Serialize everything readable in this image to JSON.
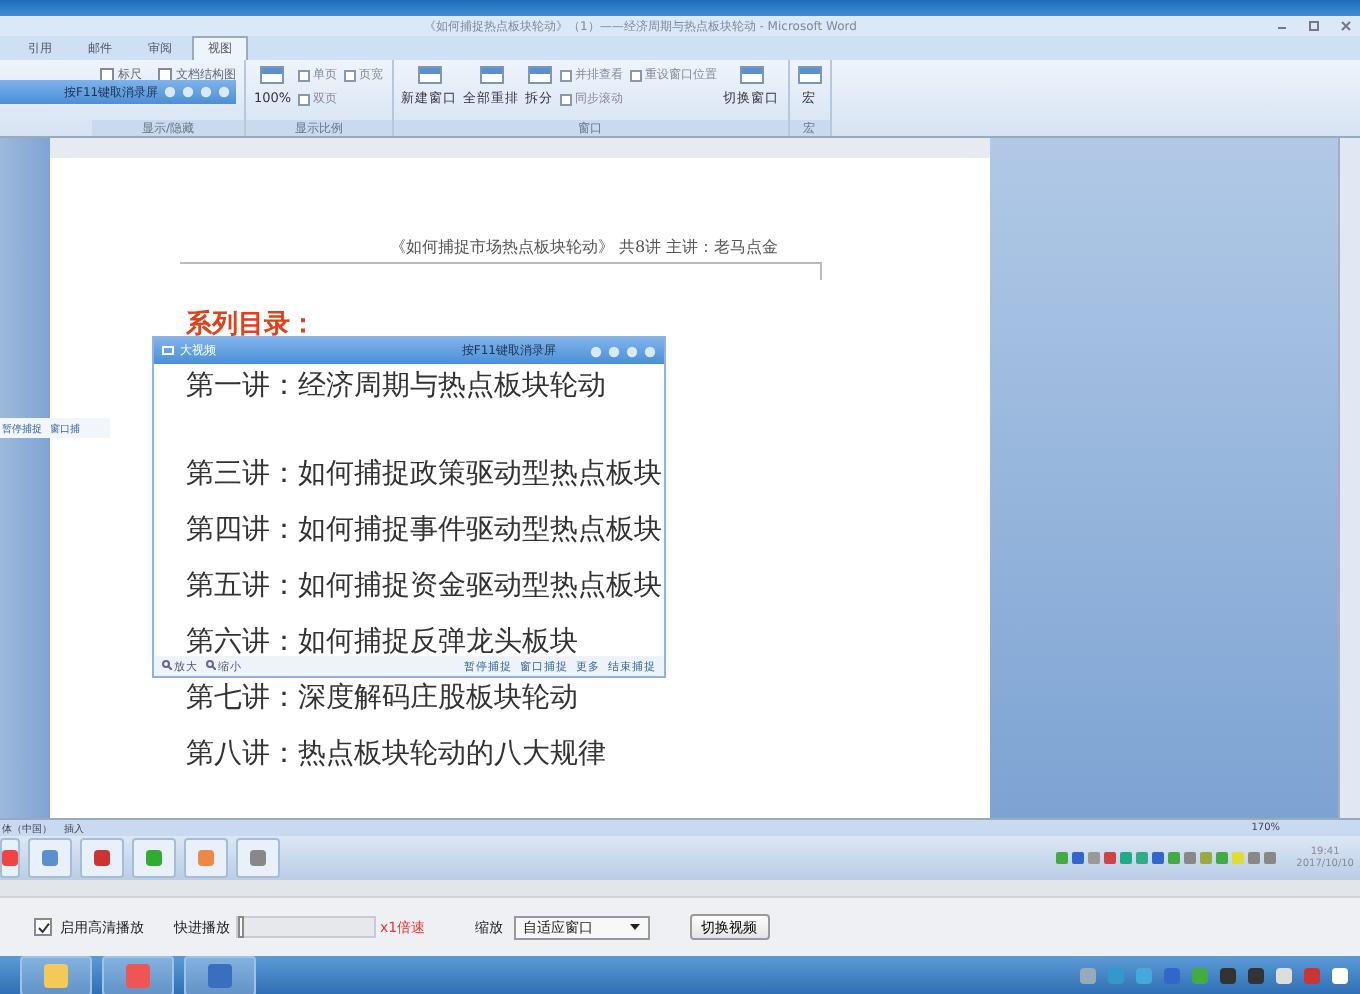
{
  "window": {
    "title": "《如何捕捉热点板块轮动》（1）——经济周期与热点板块轮动 - Microsoft Word"
  },
  "ribbon": {
    "tabs": [
      {
        "label": "引用",
        "selected": false
      },
      {
        "label": "邮件",
        "selected": false
      },
      {
        "label": "审阅",
        "selected": false
      },
      {
        "label": "视图",
        "selected": true
      }
    ],
    "groups": [
      {
        "label": "显示/隐藏",
        "items": [
          {
            "kind": "checkbox",
            "label": "标尺",
            "checked": false
          },
          {
            "kind": "checkbox",
            "label": "文档结构图",
            "checked": false
          }
        ]
      },
      {
        "label": "显示比例",
        "items": [
          {
            "kind": "large",
            "label": "100%"
          },
          {
            "kind": "small",
            "label": "单页"
          },
          {
            "kind": "small",
            "label": "双页"
          },
          {
            "kind": "small",
            "label": "页宽"
          }
        ]
      },
      {
        "label": "窗口",
        "items": [
          {
            "kind": "large",
            "label": "新建窗口"
          },
          {
            "kind": "large",
            "label": "全部重排"
          },
          {
            "kind": "large",
            "label": "拆分"
          },
          {
            "kind": "small",
            "label": "并排查看"
          },
          {
            "kind": "small",
            "label": "同步滚动"
          },
          {
            "kind": "small",
            "label": "重设窗口位置"
          },
          {
            "kind": "large",
            "label": "切换窗口"
          }
        ]
      },
      {
        "label": "宏",
        "items": [
          {
            "kind": "large",
            "label": "宏"
          }
        ]
      }
    ]
  },
  "capture_toolbar": {
    "title": "按F11键取消录屏"
  },
  "capture_side_strip": {
    "items": [
      "暂停捕捉",
      "窗口捕"
    ]
  },
  "document": {
    "header": "《如何捕捉市场热点板块轮动》 共8讲  主讲：老马点金",
    "heading": "系列目录：",
    "lines": [
      "第一讲：经济周期与热点板块轮动",
      "第三讲：如何捕捉政策驱动型热点板块",
      "第四讲：如何捕捉事件驱动型热点板块",
      "第五讲：如何捕捉资金驱动型热点板块",
      "第六讲：如何捕捉反弹龙头板块",
      "第七讲：深度解码庄股板块轮动",
      "第八讲：热点板块轮动的八大规律"
    ]
  },
  "capture_dialog": {
    "app_name": "大视频",
    "hint": "按F11键取消录屏",
    "zoom_actions": [
      "放大",
      "缩小"
    ],
    "actions": [
      "暂停捕捉",
      "窗口捕捉",
      "更多",
      "结束捕捉"
    ]
  },
  "status_bar": {
    "language": "体（中国）",
    "mode": "插入",
    "zoom": "170%"
  },
  "recorded_taskbar": {
    "time": "19:41",
    "date": "2017/10/10"
  },
  "player": {
    "hd": {
      "label": "启用高清播放",
      "checked": true
    },
    "fast_forward": {
      "label": "快进播放",
      "level": 0,
      "speed": "x1倍速"
    },
    "zoom": {
      "label": "缩放",
      "value": "自适应窗口"
    },
    "switch_button": "切换视频"
  }
}
